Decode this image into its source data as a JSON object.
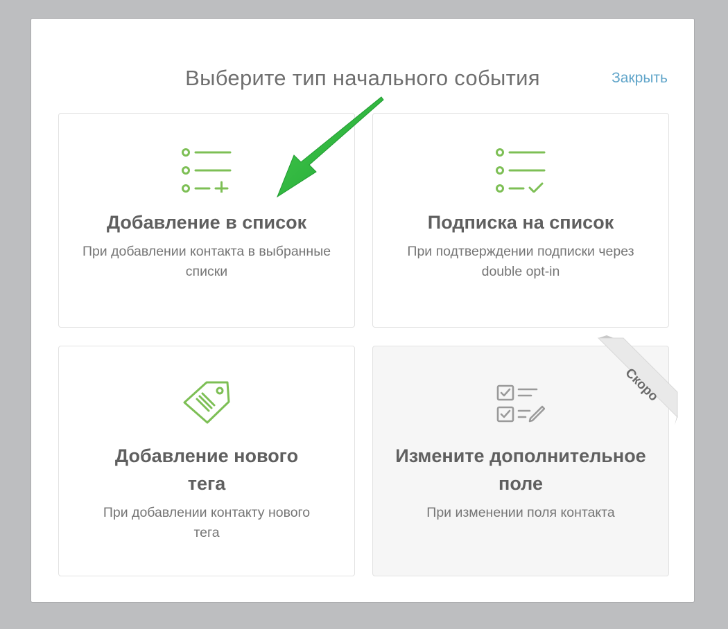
{
  "modal": {
    "title": "Выберите тип начального события",
    "close_label": "Закрыть"
  },
  "cards": [
    {
      "title": "Добавление в список",
      "description": "При добавлении контакта в выбранные списки",
      "icon": "list-add-icon",
      "status": "active"
    },
    {
      "title": "Подписка на список",
      "description": "При подтверждении подписки через double opt-in",
      "icon": "list-check-icon",
      "status": "active"
    },
    {
      "title": "Добавление нового тега",
      "description": "При добавлении контакту нового тега",
      "icon": "tag-icon",
      "status": "active"
    },
    {
      "title": "Измените дополнительное поле",
      "description": "При изменении поля контакта",
      "icon": "checklist-edit-icon",
      "status": "disabled",
      "badge": "Скоро"
    }
  ],
  "colors": {
    "accent_green": "#7dbf55",
    "link_blue": "#5fa4c9",
    "arrow_green": "#2db33d",
    "muted_icon": "#9a9a9a"
  }
}
